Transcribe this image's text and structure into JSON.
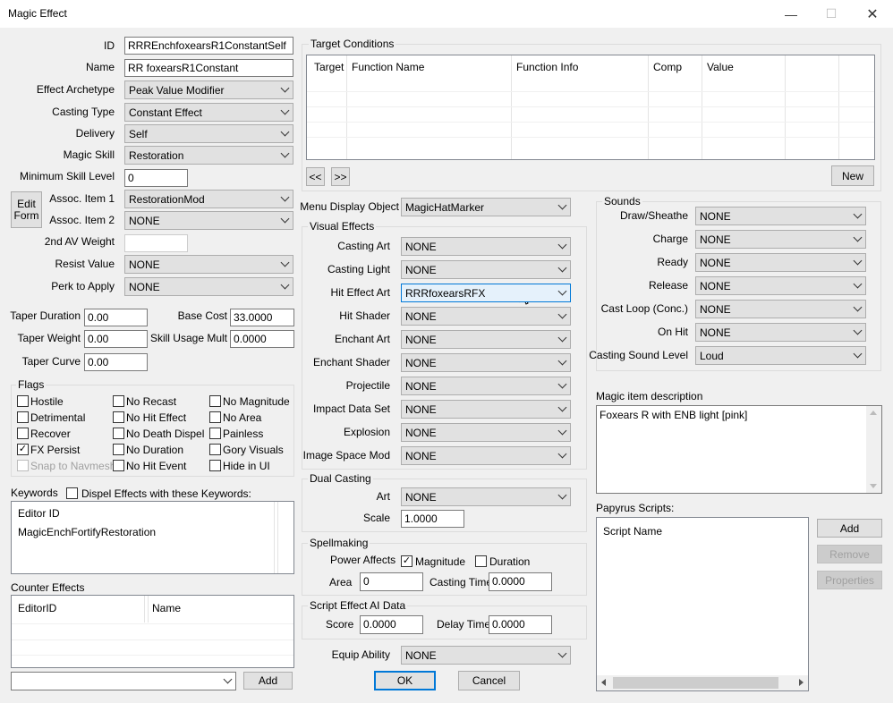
{
  "window": {
    "title": "Magic Effect",
    "minimize": "—",
    "maximize": "☐",
    "close": "✕"
  },
  "left": {
    "id_label": "ID",
    "id_value": "RRREnchfoxearsR1ConstantSelf",
    "name_label": "Name",
    "name_value": "RR foxearsR1Constant",
    "archetype_label": "Effect Archetype",
    "archetype_value": "Peak Value Modifier",
    "casting_type_label": "Casting Type",
    "casting_type_value": "Constant Effect",
    "delivery_label": "Delivery",
    "delivery_value": "Self",
    "magic_skill_label": "Magic Skill",
    "magic_skill_value": "Restoration",
    "min_skill_label": "Minimum Skill Level",
    "min_skill_value": "0",
    "edit_form_line1": "Edit",
    "edit_form_line2": "Form",
    "assoc1_label": "Assoc. Item 1",
    "assoc1_value": "RestorationMod",
    "assoc2_label": "Assoc. Item 2",
    "assoc2_value": "NONE",
    "av2_label": "2nd AV Weight",
    "av2_value": "",
    "resist_label": "Resist Value",
    "resist_value": "NONE",
    "perk_label": "Perk to Apply",
    "perk_value": "NONE",
    "taper_duration_label": "Taper Duration",
    "taper_duration_value": "0.00",
    "base_cost_label": "Base Cost",
    "base_cost_value": "33.0000",
    "taper_weight_label": "Taper Weight",
    "taper_weight_value": "0.00",
    "skill_usage_label": "Skill Usage Mult",
    "skill_usage_value": "0.0000",
    "taper_curve_label": "Taper Curve",
    "taper_curve_value": "0.00"
  },
  "flags": {
    "title": "Flags",
    "items": [
      {
        "label": "Hostile",
        "checked": "",
        "disabled": false
      },
      {
        "label": "No Recast",
        "checked": "",
        "disabled": false
      },
      {
        "label": "No Magnitude",
        "checked": "",
        "disabled": false
      },
      {
        "label": "Detrimental",
        "checked": "",
        "disabled": false
      },
      {
        "label": "No Hit Effect",
        "checked": "",
        "disabled": false
      },
      {
        "label": "No Area",
        "checked": "",
        "disabled": false
      },
      {
        "label": "Recover",
        "checked": "",
        "disabled": false
      },
      {
        "label": "No Death Dispel",
        "checked": "",
        "disabled": false
      },
      {
        "label": "Painless",
        "checked": "",
        "disabled": false
      },
      {
        "label": "FX Persist",
        "checked": "✓",
        "disabled": false
      },
      {
        "label": "No Duration",
        "checked": "",
        "disabled": false
      },
      {
        "label": "Gory Visuals",
        "checked": "",
        "disabled": false
      },
      {
        "label": "Snap to Navmesh",
        "checked": "",
        "disabled": true
      },
      {
        "label": "No Hit Event",
        "checked": "",
        "disabled": false
      },
      {
        "label": "Hide in UI",
        "checked": "",
        "disabled": false
      }
    ]
  },
  "keywords": {
    "title": "Keywords",
    "dispel_label": "Dispel Effects with these Keywords:",
    "col_header": "Editor ID",
    "rows": [
      "MagicEnchFortifyRestoration"
    ]
  },
  "counter": {
    "title": "Counter Effects",
    "col1": "EditorID",
    "col2": "Name",
    "combo_value": "",
    "add_label": "Add"
  },
  "target_conditions": {
    "title": "Target Conditions",
    "columns": [
      "Target",
      "Function Name",
      "Function Info",
      "Comp",
      "Value"
    ],
    "prev_label": "<<",
    "next_label": ">>",
    "new_label": "New"
  },
  "menu_display": {
    "label": "Menu Display Object",
    "value": "MagicHatMarker"
  },
  "visual_effects": {
    "title": "Visual Effects",
    "items": [
      {
        "label": "Casting Art",
        "value": "NONE"
      },
      {
        "label": "Casting Light",
        "value": "NONE"
      },
      {
        "label": "Hit Effect Art",
        "value": "RRRfoxearsRFX"
      },
      {
        "label": "Hit Shader",
        "value": "NONE"
      },
      {
        "label": "Enchant Art",
        "value": "NONE"
      },
      {
        "label": "Enchant Shader",
        "value": "NONE"
      },
      {
        "label": "Projectile",
        "value": "NONE"
      },
      {
        "label": "Impact Data Set",
        "value": "NONE"
      },
      {
        "label": "Explosion",
        "value": "NONE"
      },
      {
        "label": "Image Space Mod",
        "value": "NONE"
      }
    ]
  },
  "dual_casting": {
    "title": "Dual Casting",
    "art_label": "Art",
    "art_value": "NONE",
    "scale_label": "Scale",
    "scale_value": "1.0000"
  },
  "spellmaking": {
    "title": "Spellmaking",
    "power_label": "Power Affects",
    "magnitude_label": "Magnitude",
    "magnitude_checked": "✓",
    "duration_label": "Duration",
    "duration_checked": "",
    "area_label": "Area",
    "area_value": "0",
    "casting_time_label": "Casting Time",
    "casting_time_value": "0.0000"
  },
  "script_ai": {
    "title": "Script Effect AI Data",
    "score_label": "Score",
    "score_value": "0.0000",
    "delay_label": "Delay Time",
    "delay_value": "0.0000"
  },
  "equip": {
    "label": "Equip Ability",
    "value": "NONE"
  },
  "buttons": {
    "ok": "OK",
    "cancel": "Cancel"
  },
  "sounds": {
    "title": "Sounds",
    "items": [
      {
        "label": "Draw/Sheathe",
        "value": "NONE"
      },
      {
        "label": "Charge",
        "value": "NONE"
      },
      {
        "label": "Ready",
        "value": "NONE"
      },
      {
        "label": "Release",
        "value": "NONE"
      },
      {
        "label": "Cast Loop (Conc.)",
        "value": "NONE"
      },
      {
        "label": "On Hit",
        "value": "NONE"
      }
    ],
    "level_label": "Casting Sound Level",
    "level_value": "Loud"
  },
  "description": {
    "label": "Magic item description",
    "value": "Foxears R with ENB light [pink]"
  },
  "papyrus": {
    "label": "Papyrus Scripts:",
    "col_header": "Script Name",
    "add_label": "Add",
    "remove_label": "Remove",
    "properties_label": "Properties"
  }
}
